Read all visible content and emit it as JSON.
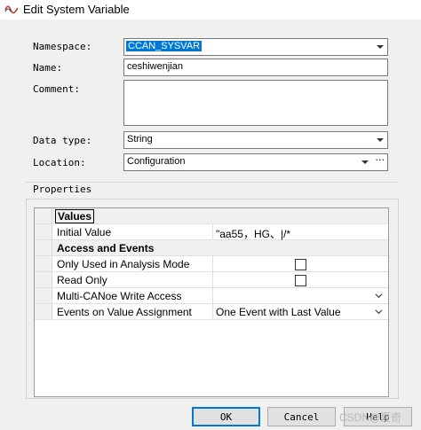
{
  "window": {
    "title": "Edit System Variable",
    "icon": "wave-icon"
  },
  "form": {
    "namespace_label": "Namespace:",
    "namespace_value": "CCAN_SYSVAR",
    "name_label": "Name:",
    "name_value": "ceshiwenjian",
    "comment_label": "Comment:",
    "comment_value": "",
    "datatype_label": "Data type:",
    "datatype_value": "String",
    "location_label": "Location:",
    "location_value": "Configuration",
    "location_more": "···"
  },
  "properties": {
    "group_label": "Properties",
    "rows": [
      {
        "key": "Values",
        "value": "",
        "type": "category"
      },
      {
        "key": "Initial Value",
        "value": "\"aa55，HG、|/*",
        "type": "text"
      },
      {
        "key": "Access and Events",
        "value": "",
        "type": "category"
      },
      {
        "key": "Only Used in Analysis Mode",
        "value": "",
        "type": "checkbox",
        "checked": false
      },
      {
        "key": "Read Only",
        "value": "",
        "type": "checkbox",
        "checked": false
      },
      {
        "key": "Multi-CANoe Write Access",
        "value": "",
        "type": "dropdown"
      },
      {
        "key": "Events on Value Assignment",
        "value": "One Event with Last Value",
        "type": "dropdown"
      }
    ]
  },
  "buttons": {
    "ok": "OK",
    "cancel": "Cancel",
    "help": "Help"
  },
  "watermark": "CSDN@夏奇",
  "colors": {
    "selection": "#0078d7",
    "title_icon": "#c0392b"
  }
}
